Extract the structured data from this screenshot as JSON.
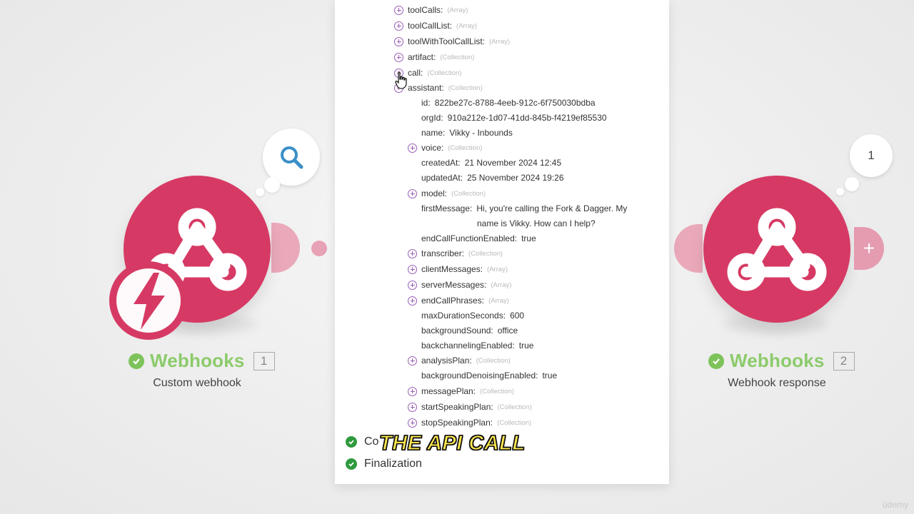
{
  "modules": [
    {
      "app_name": "Webhooks",
      "number": "1",
      "subtitle": "Custom webhook",
      "brand_color": "#d63a64",
      "icon": "webhook-icon",
      "badge_icon": "lightning-icon",
      "bubble_icon": "search-icon"
    },
    {
      "app_name": "Webhooks",
      "number": "2",
      "subtitle": "Webhook response",
      "brand_color": "#d63a64",
      "icon": "webhook-icon",
      "bubble_count": "1"
    }
  ],
  "tree": [
    {
      "key": "toolCalls:",
      "type": "(Array)",
      "expandable": true
    },
    {
      "key": "toolCallList:",
      "type": "(Array)",
      "expandable": true
    },
    {
      "key": "toolWithToolCallList:",
      "type": "(Array)",
      "expandable": true
    },
    {
      "key": "artifact:",
      "type": "(Collection)",
      "expandable": true
    },
    {
      "key": "call:",
      "type": "(Collection)",
      "expandable": true
    },
    {
      "key": "assistant:",
      "type": "(Collection)",
      "expandable": true
    },
    {
      "key": "id:",
      "value": "822be27c-8788-4eeb-912c-6f750030bdba"
    },
    {
      "key": "orgId:",
      "value": "910a212e-1d07-41dd-845b-f4219ef85530"
    },
    {
      "key": "name:",
      "value": "Vikky - Inbounds"
    },
    {
      "key": "voice:",
      "type": "(Collection)",
      "expandable": true
    },
    {
      "key": "createdAt:",
      "value": "21 November 2024 12:45"
    },
    {
      "key": "updatedAt:",
      "value": "25 November 2024 19:26"
    },
    {
      "key": "model:",
      "type": "(Collection)",
      "expandable": true
    },
    {
      "key": "firstMessage:",
      "value": "Hi, you're calling the Fork & Dagger. My",
      "value_cont": "name is Vikky. How can I help?"
    },
    {
      "key": "endCallFunctionEnabled:",
      "value": "true"
    },
    {
      "key": "transcriber:",
      "type": "(Collection)",
      "expandable": true
    },
    {
      "key": "clientMessages:",
      "type": "(Array)",
      "expandable": true
    },
    {
      "key": "serverMessages:",
      "type": "(Array)",
      "expandable": true
    },
    {
      "key": "endCallPhrases:",
      "type": "(Array)",
      "expandable": true
    },
    {
      "key": "maxDurationSeconds:",
      "value": "600"
    },
    {
      "key": "backgroundSound:",
      "value": "office"
    },
    {
      "key": "backchannelingEnabled:",
      "value": "true"
    },
    {
      "key": "analysisPlan:",
      "type": "(Collection)",
      "expandable": true
    },
    {
      "key": "backgroundDenoisingEnabled:",
      "value": "true"
    },
    {
      "key": "messagePlan:",
      "type": "(Collection)",
      "expandable": true
    },
    {
      "key": "startSpeakingPlan:",
      "type": "(Collection)",
      "expandable": true
    },
    {
      "key": "stopSpeakingPlan:",
      "type": "(Collection)",
      "expandable": true
    }
  ],
  "status": {
    "items": [
      {
        "label": "Co"
      },
      {
        "label": "Finalization"
      }
    ]
  },
  "caption": "THE API CALL",
  "watermark": "ûdemy",
  "colors": {
    "brand": "#d63a64",
    "success": "#7dc35a",
    "expander": "#9a5db6",
    "caption_fill": "#ffe84d"
  }
}
